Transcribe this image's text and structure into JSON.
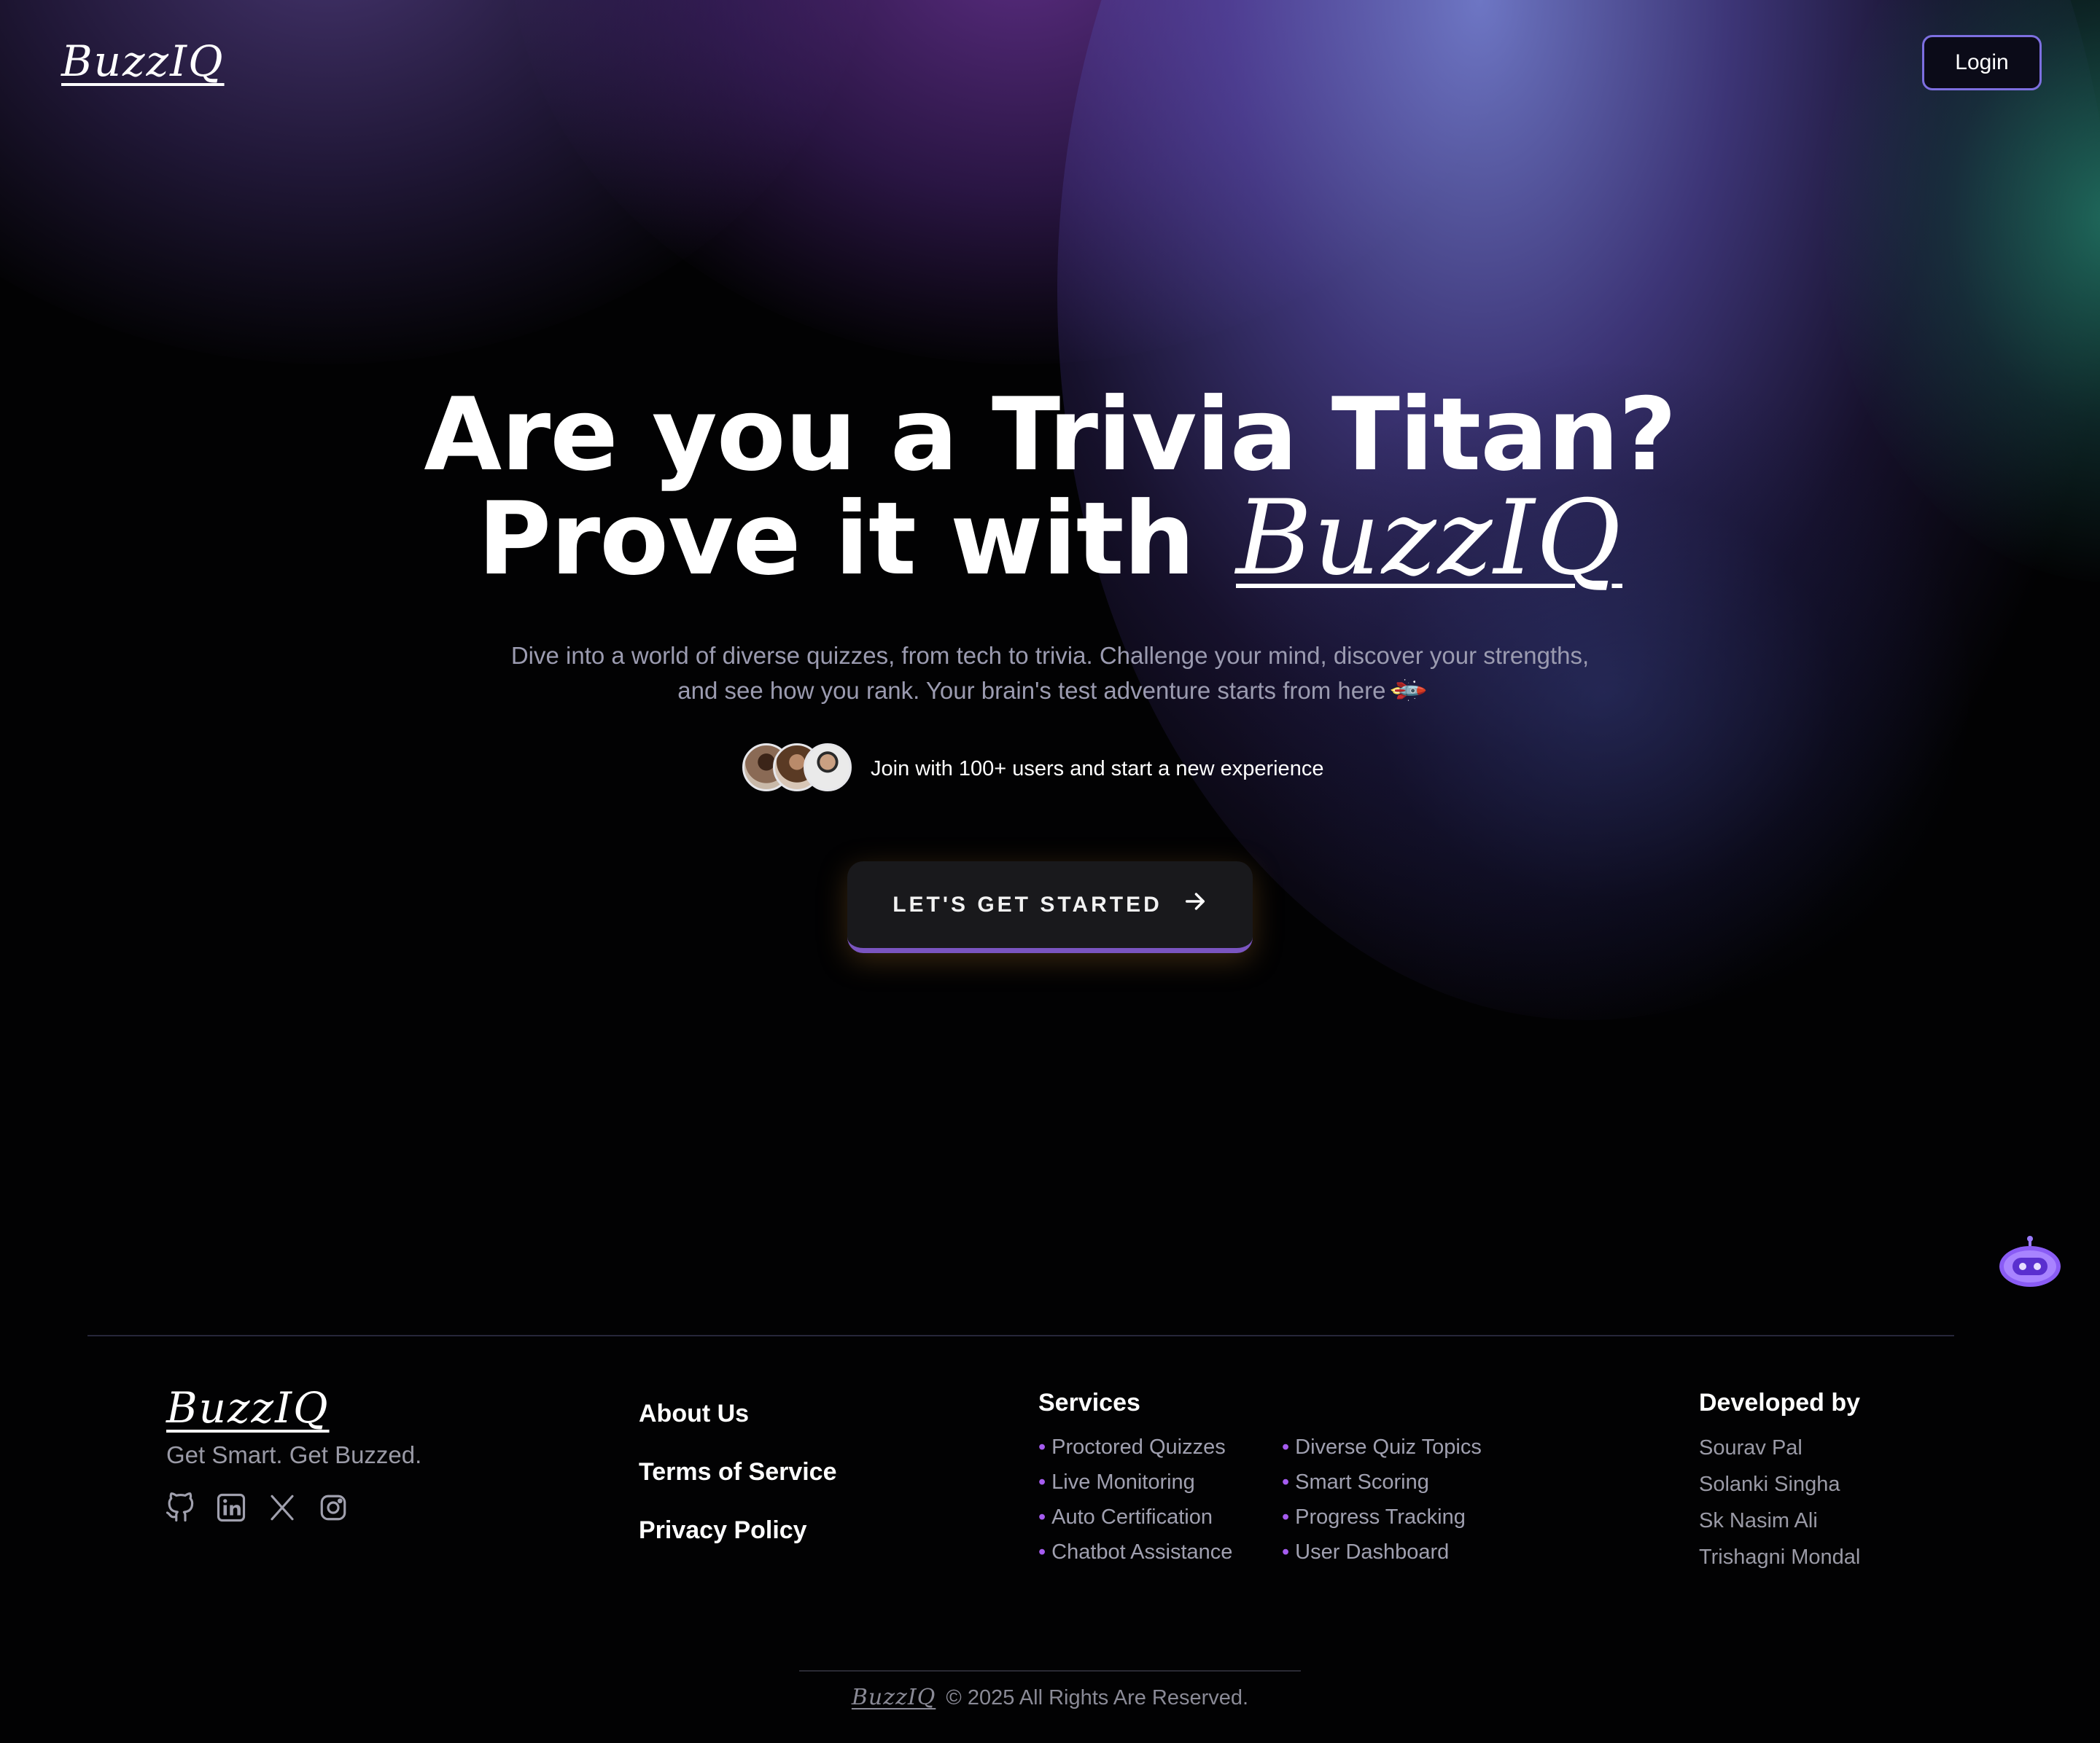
{
  "brand": {
    "name": "BuzzIQ"
  },
  "header": {
    "login_label": "Login"
  },
  "hero": {
    "title_line1": "Are you a Trivia Titan?",
    "title_line2_prefix": "Prove it with",
    "title_line2_brand": "BuzzIQ",
    "description": "Dive into a world of diverse quizzes, from tech to trivia. Challenge your mind, discover your strengths, and see how you rank. Your brain's test adventure starts from here",
    "description_emoji": "🚀",
    "join_text": "Join with 100+ users and start a new experience",
    "cta_label": "LET'S GET STARTED",
    "cta_icon": "arrow-right-icon"
  },
  "chatbot": {
    "icon": "robot-icon",
    "color": "#8a5cf5"
  },
  "footer": {
    "tagline": "Get Smart. Get Buzzed.",
    "socials": [
      "github-icon",
      "linkedin-icon",
      "x-icon",
      "instagram-icon"
    ],
    "links": [
      "About Us",
      "Terms of Service",
      "Privacy Policy"
    ],
    "services_title": "Services",
    "services_col1": [
      "Proctored Quizzes",
      "Live Monitoring",
      "Auto Certification",
      "Chatbot Assistance"
    ],
    "services_col2": [
      "Diverse Quiz Topics",
      "Smart Scoring",
      "Progress Tracking",
      "User Dashboard"
    ],
    "developers_title": "Developed by",
    "developers": [
      "Sourav Pal",
      "Solanki Singha",
      "Sk Nasim Ali",
      "Trishagni Mondal"
    ],
    "copyright_text": "© 2025 All Rights Are Reserved."
  },
  "colors": {
    "background": "#020203",
    "accent_purple": "#7a55c0",
    "service_bullet": "#a55cf0",
    "login_border": "#7d6fe0"
  }
}
